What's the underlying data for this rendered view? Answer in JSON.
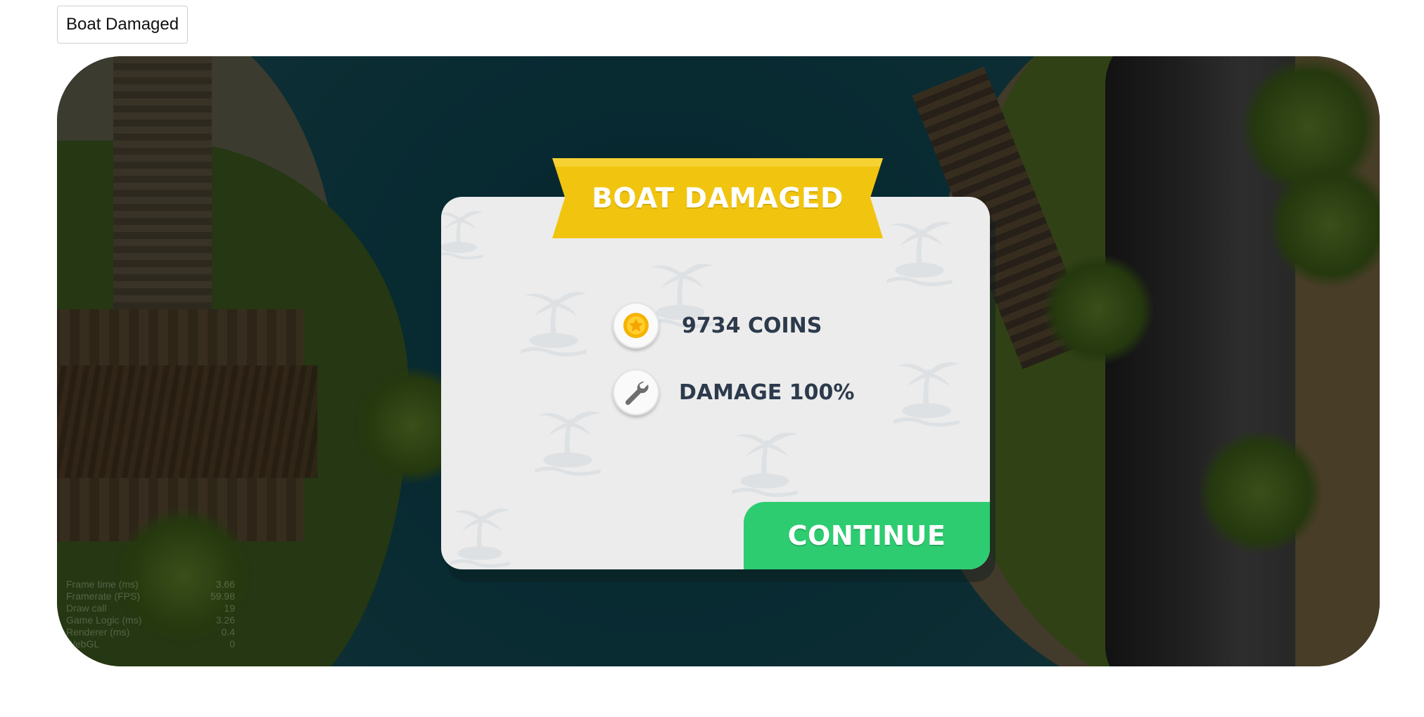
{
  "page": {
    "label": "Boat Damaged"
  },
  "dialog": {
    "title": "BOAT DAMAGED",
    "coins_text": "9734 COINS",
    "damage_text": "DAMAGE 100%",
    "continue_label": "CONTINUE"
  },
  "debug_stats": [
    {
      "label": "Frame time (ms)",
      "value": "3.66"
    },
    {
      "label": "Framerate (FPS)",
      "value": "59.98"
    },
    {
      "label": "Draw call",
      "value": "19"
    },
    {
      "label": "Game Logic (ms)",
      "value": "3.26"
    },
    {
      "label": "Renderer (ms)",
      "value": "0.4"
    },
    {
      "label": "WebGL",
      "value": "0"
    }
  ],
  "colors": {
    "banner": "#f1c40f",
    "continue": "#2ecc71",
    "panel": "#ececec",
    "text": "#2c3a4c"
  },
  "icons": [
    "coin-icon",
    "wrench-icon",
    "palm-island-icon"
  ]
}
